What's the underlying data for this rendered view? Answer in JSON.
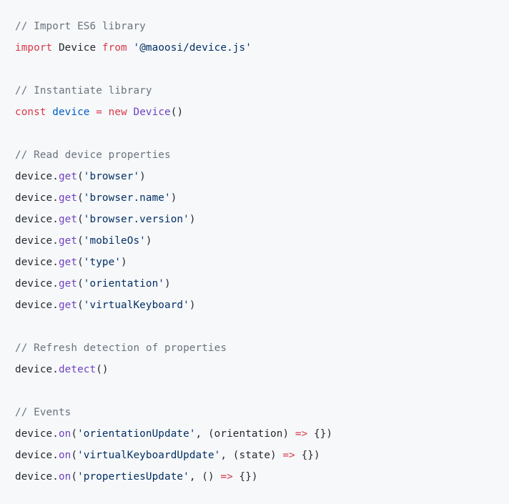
{
  "code": {
    "tokens": [
      [
        {
          "t": "// Import ES6 library",
          "c": "comment"
        }
      ],
      [
        {
          "t": "import",
          "c": "keyword"
        },
        {
          "t": " Device ",
          "c": "default"
        },
        {
          "t": "from",
          "c": "keyword"
        },
        {
          "t": " ",
          "c": "default"
        },
        {
          "t": "'@maoosi/device.js'",
          "c": "string"
        }
      ],
      [],
      [
        {
          "t": "// Instantiate library",
          "c": "comment"
        }
      ],
      [
        {
          "t": "const",
          "c": "keyword"
        },
        {
          "t": " ",
          "c": "default"
        },
        {
          "t": "device",
          "c": "declare"
        },
        {
          "t": " ",
          "c": "default"
        },
        {
          "t": "=",
          "c": "keyword"
        },
        {
          "t": " ",
          "c": "default"
        },
        {
          "t": "new",
          "c": "keyword"
        },
        {
          "t": " ",
          "c": "default"
        },
        {
          "t": "Device",
          "c": "func"
        },
        {
          "t": "()",
          "c": "default"
        }
      ],
      [],
      [
        {
          "t": "// Read device properties",
          "c": "comment"
        }
      ],
      [
        {
          "t": "device.",
          "c": "default"
        },
        {
          "t": "get",
          "c": "func"
        },
        {
          "t": "(",
          "c": "default"
        },
        {
          "t": "'browser'",
          "c": "string"
        },
        {
          "t": ")",
          "c": "default"
        }
      ],
      [
        {
          "t": "device.",
          "c": "default"
        },
        {
          "t": "get",
          "c": "func"
        },
        {
          "t": "(",
          "c": "default"
        },
        {
          "t": "'browser.name'",
          "c": "string"
        },
        {
          "t": ")",
          "c": "default"
        }
      ],
      [
        {
          "t": "device.",
          "c": "default"
        },
        {
          "t": "get",
          "c": "func"
        },
        {
          "t": "(",
          "c": "default"
        },
        {
          "t": "'browser.version'",
          "c": "string"
        },
        {
          "t": ")",
          "c": "default"
        }
      ],
      [
        {
          "t": "device.",
          "c": "default"
        },
        {
          "t": "get",
          "c": "func"
        },
        {
          "t": "(",
          "c": "default"
        },
        {
          "t": "'mobileOs'",
          "c": "string"
        },
        {
          "t": ")",
          "c": "default"
        }
      ],
      [
        {
          "t": "device.",
          "c": "default"
        },
        {
          "t": "get",
          "c": "func"
        },
        {
          "t": "(",
          "c": "default"
        },
        {
          "t": "'type'",
          "c": "string"
        },
        {
          "t": ")",
          "c": "default"
        }
      ],
      [
        {
          "t": "device.",
          "c": "default"
        },
        {
          "t": "get",
          "c": "func"
        },
        {
          "t": "(",
          "c": "default"
        },
        {
          "t": "'orientation'",
          "c": "string"
        },
        {
          "t": ")",
          "c": "default"
        }
      ],
      [
        {
          "t": "device.",
          "c": "default"
        },
        {
          "t": "get",
          "c": "func"
        },
        {
          "t": "(",
          "c": "default"
        },
        {
          "t": "'virtualKeyboard'",
          "c": "string"
        },
        {
          "t": ")",
          "c": "default"
        }
      ],
      [],
      [
        {
          "t": "// Refresh detection of properties",
          "c": "comment"
        }
      ],
      [
        {
          "t": "device.",
          "c": "default"
        },
        {
          "t": "detect",
          "c": "func"
        },
        {
          "t": "()",
          "c": "default"
        }
      ],
      [],
      [
        {
          "t": "// Events",
          "c": "comment"
        }
      ],
      [
        {
          "t": "device.",
          "c": "default"
        },
        {
          "t": "on",
          "c": "func"
        },
        {
          "t": "(",
          "c": "default"
        },
        {
          "t": "'orientationUpdate'",
          "c": "string"
        },
        {
          "t": ", (orientation) ",
          "c": "default"
        },
        {
          "t": "=>",
          "c": "keyword"
        },
        {
          "t": " {})",
          "c": "default"
        }
      ],
      [
        {
          "t": "device.",
          "c": "default"
        },
        {
          "t": "on",
          "c": "func"
        },
        {
          "t": "(",
          "c": "default"
        },
        {
          "t": "'virtualKeyboardUpdate'",
          "c": "string"
        },
        {
          "t": ", (state) ",
          "c": "default"
        },
        {
          "t": "=>",
          "c": "keyword"
        },
        {
          "t": " {})",
          "c": "default"
        }
      ],
      [
        {
          "t": "device.",
          "c": "default"
        },
        {
          "t": "on",
          "c": "func"
        },
        {
          "t": "(",
          "c": "default"
        },
        {
          "t": "'propertiesUpdate'",
          "c": "string"
        },
        {
          "t": ", () ",
          "c": "default"
        },
        {
          "t": "=>",
          "c": "keyword"
        },
        {
          "t": " {})",
          "c": "default"
        }
      ]
    ]
  }
}
